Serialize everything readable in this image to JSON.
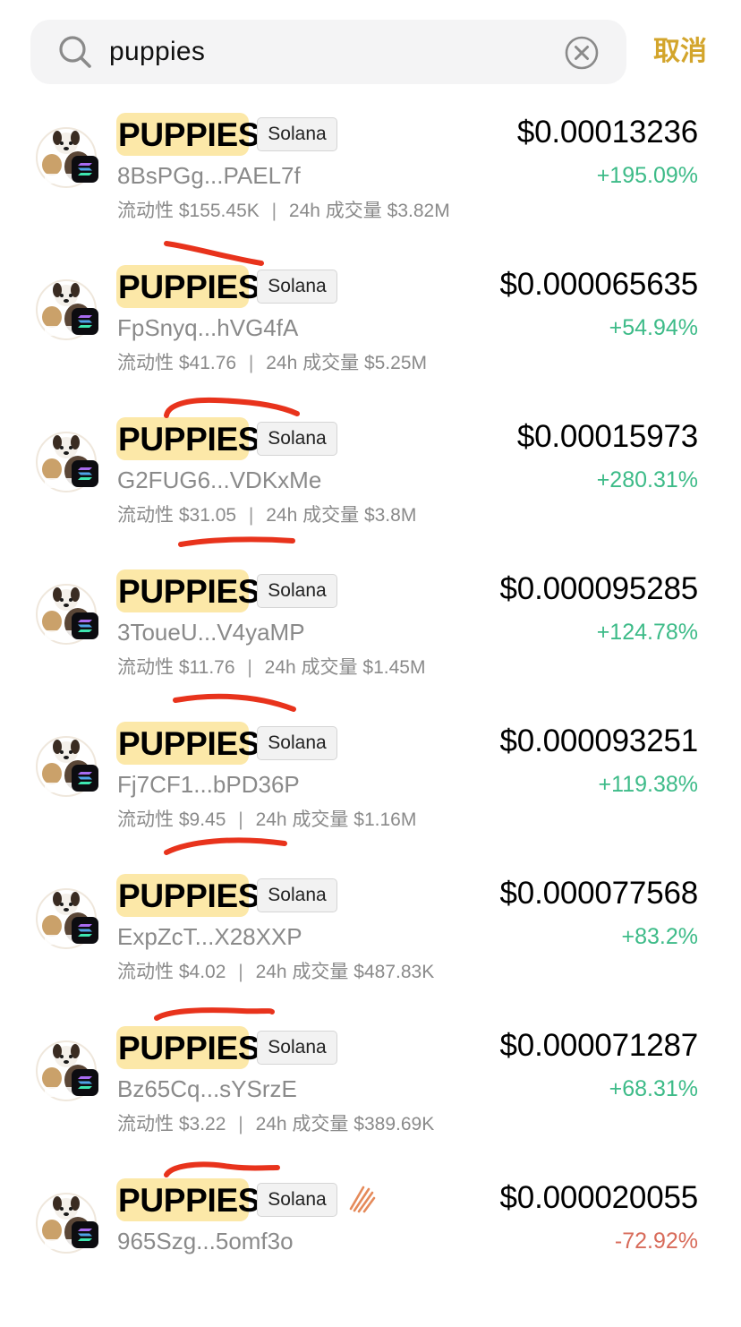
{
  "search": {
    "query": "puppies",
    "cancel_label": "取消"
  },
  "labels": {
    "liquidity": "流动性",
    "volume": "24h 成交量",
    "separator": "|"
  },
  "colors": {
    "positive": "#3dbb88",
    "negative": "#d86b5a",
    "accent": "#d3a52c",
    "highlight": "#fce8a8",
    "pen": "#e8331c"
  },
  "results": [
    {
      "name": "PUPPIES",
      "chain": "Solana",
      "address": "8BsPGg...PAEL7f",
      "price": "$0.00013236",
      "change": "+195.09%",
      "liquidity": "$155.45K",
      "volume": "$3.82M"
    },
    {
      "name": "PUPPIES",
      "chain": "Solana",
      "address": "FpSnyq...hVG4fA",
      "price": "$0.000065635",
      "change": "+54.94%",
      "liquidity": "$41.76",
      "volume": "$5.25M"
    },
    {
      "name": "PUPPIES",
      "chain": "Solana",
      "address": "G2FUG6...VDKxMe",
      "price": "$0.00015973",
      "change": "+280.31%",
      "liquidity": "$31.05",
      "volume": "$3.8M"
    },
    {
      "name": "PUPPIES",
      "chain": "Solana",
      "address": "3ToueU...V4yaMP",
      "price": "$0.000095285",
      "change": "+124.78%",
      "liquidity": "$11.76",
      "volume": "$1.45M"
    },
    {
      "name": "PUPPIES",
      "chain": "Solana",
      "address": "Fj7CF1...bPD36P",
      "price": "$0.000093251",
      "change": "+119.38%",
      "liquidity": "$9.45",
      "volume": "$1.16M"
    },
    {
      "name": "PUPPIES",
      "chain": "Solana",
      "address": "ExpZcT...X28XXP",
      "price": "$0.000077568",
      "change": "+83.2%",
      "liquidity": "$4.02",
      "volume": "$487.83K"
    },
    {
      "name": "PUPPIES",
      "chain": "Solana",
      "address": "Bz65Cq...sYSrzE",
      "price": "$0.000071287",
      "change": "+68.31%",
      "liquidity": "$3.22",
      "volume": "$389.69K"
    },
    {
      "name": "PUPPIES",
      "chain": "Solana",
      "address": "965Szg...5omf3o",
      "price": "$0.000020055",
      "change": "-72.92%",
      "trending_icon": "striped-flame-icon"
    }
  ]
}
